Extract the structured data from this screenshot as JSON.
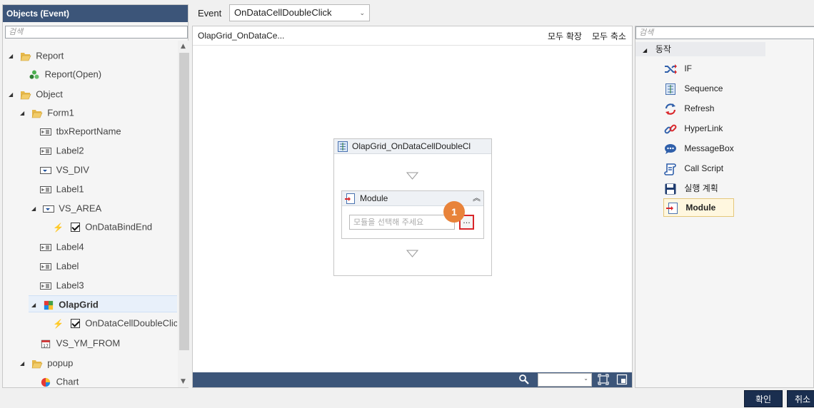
{
  "left_panel": {
    "title": "Objects (Event)",
    "search_placeholder": "검색",
    "tree": [
      {
        "label": "Report"
      },
      {
        "label": "Report(Open)"
      },
      {
        "label": "Object"
      },
      {
        "label": "Form1"
      },
      {
        "label": "tbxReportName"
      },
      {
        "label": "Label2"
      },
      {
        "label": "VS_DIV"
      },
      {
        "label": "Label1"
      },
      {
        "label": "VS_AREA"
      },
      {
        "label": "OnDataBindEnd"
      },
      {
        "label": "Label4"
      },
      {
        "label": "Label"
      },
      {
        "label": "Label3"
      },
      {
        "label": "OlapGrid"
      },
      {
        "label": "OnDataCellDoubleClick"
      },
      {
        "label": "VS_YM_FROM"
      },
      {
        "label": "popup"
      },
      {
        "label": "Chart"
      }
    ]
  },
  "event": {
    "label": "Event",
    "selected": "OnDataCellDoubleClick"
  },
  "canvas": {
    "title": "OlapGrid_OnDataCe...",
    "expand_all": "모두 확장",
    "collapse_all": "모두 축소",
    "sequence_title": "OlapGrid_OnDataCellDoubleCl",
    "module_title": "Module",
    "module_placeholder": "모듈을 선택해 주세요",
    "browse_label": "...",
    "badge": "1"
  },
  "right_panel": {
    "search_placeholder": "검색",
    "group_label": "동작",
    "actions": [
      {
        "label": "IF"
      },
      {
        "label": "Sequence"
      },
      {
        "label": "Refresh"
      },
      {
        "label": "HyperLink"
      },
      {
        "label": "MessageBox"
      },
      {
        "label": "Call Script"
      },
      {
        "label": "실행 계획"
      },
      {
        "label": "Module"
      }
    ]
  },
  "buttons": {
    "ok": "확인",
    "cancel": "취소"
  },
  "colors": {
    "title_bar": "#3c5579",
    "badge": "#e8833a",
    "highlight_border": "#d9262a",
    "button_bg": "#1a2e4f"
  }
}
